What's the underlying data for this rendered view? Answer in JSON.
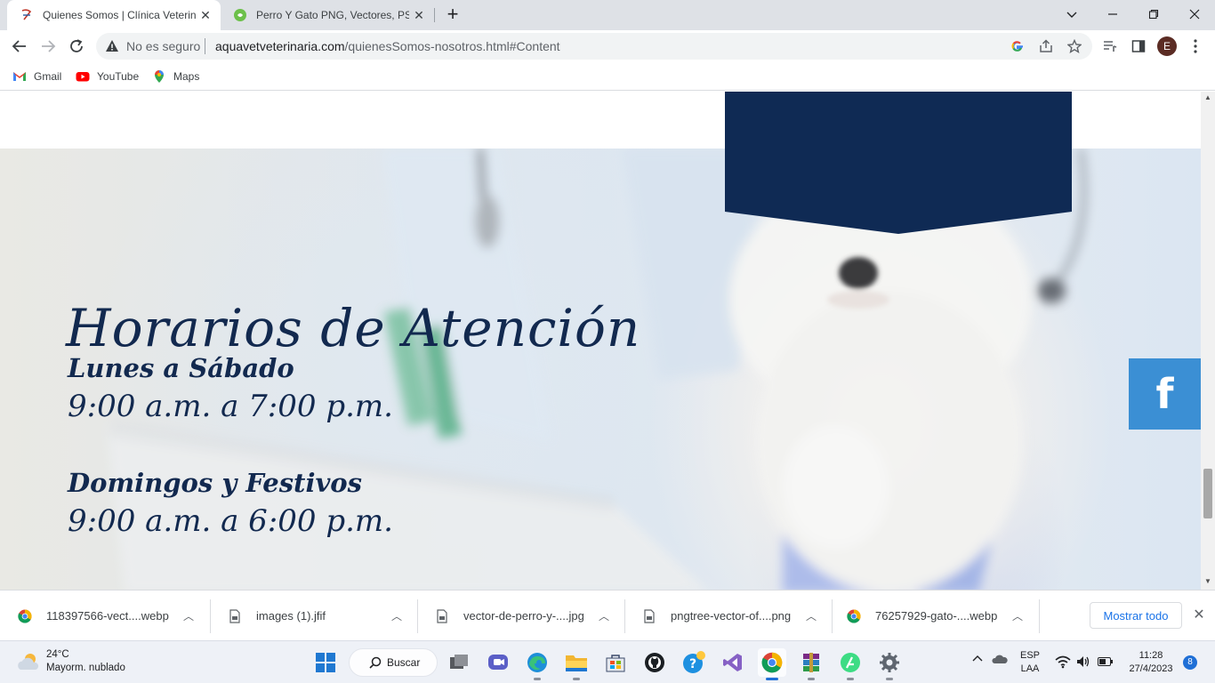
{
  "tabs": [
    {
      "title": "Quienes Somos | Clínica Veterinaria",
      "active": true
    },
    {
      "title": "Perro Y Gato PNG, Vectores, PSD, e Iconos",
      "active": false
    }
  ],
  "new_tab_icon": "plus-icon",
  "window_controls": [
    "tab-search-icon",
    "minimize-icon",
    "restore-icon",
    "close-icon"
  ],
  "toolbar": {
    "security_label": "No es seguro",
    "url_host": "aquavetveterinaria.com",
    "url_path": "/quienesSomos-nosotros.html#Content",
    "profile_initial": "E"
  },
  "bookmarks": [
    {
      "label": "Gmail",
      "icon": "gmail-icon"
    },
    {
      "label": "YouTube",
      "icon": "youtube-icon"
    },
    {
      "label": "Maps",
      "icon": "maps-icon"
    }
  ],
  "page": {
    "hours_title": "Horarios de Atención",
    "schedule": [
      {
        "days": "Lunes a Sábado",
        "hours": "9:00 a.m. a 7:00 p.m."
      },
      {
        "days": "Domingos y Festivos",
        "hours": "9:00 a.m. a 6:00 p.m."
      }
    ],
    "facebook_glyph": "f",
    "colors": {
      "navy": "#0f2a54",
      "facebook": "#3b8fd4"
    }
  },
  "downloads": [
    {
      "name": "118397566-vect....webp",
      "icon": "chrome-icon"
    },
    {
      "name": "images (1).jfif",
      "icon": "file-icon"
    },
    {
      "name": "vector-de-perro-y-....jpg",
      "icon": "file-icon"
    },
    {
      "name": "pngtree-vector-of....png",
      "icon": "file-icon"
    },
    {
      "name": "76257929-gato-....webp",
      "icon": "chrome-icon"
    }
  ],
  "downloads_show_all": "Mostrar todo",
  "taskbar": {
    "weather_temp": "24°C",
    "weather_desc": "Mayorm. nublado",
    "search_label": "Buscar",
    "lang_line1": "ESP",
    "lang_line2": "LAA",
    "time": "11:28",
    "date": "27/4/2023",
    "notification_count": "8"
  }
}
